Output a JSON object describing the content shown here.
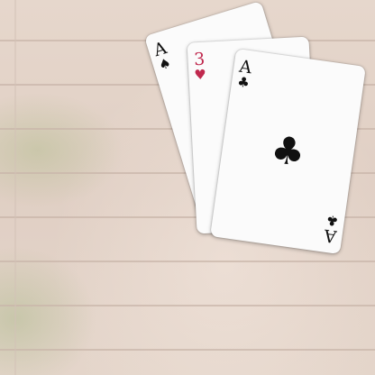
{
  "table": {
    "background_color": "#e2d2c7"
  },
  "cards": [
    {
      "rank": "A",
      "suit": "♠",
      "suit_name": "spades",
      "color": "black"
    },
    {
      "rank": "3",
      "suit": "♥",
      "suit_name": "hearts",
      "color": "red"
    },
    {
      "rank": "A",
      "suit": "♣",
      "suit_name": "clubs",
      "color": "black"
    }
  ],
  "colors": {
    "black_suit": "#111111",
    "red_suit": "#c0294e"
  }
}
